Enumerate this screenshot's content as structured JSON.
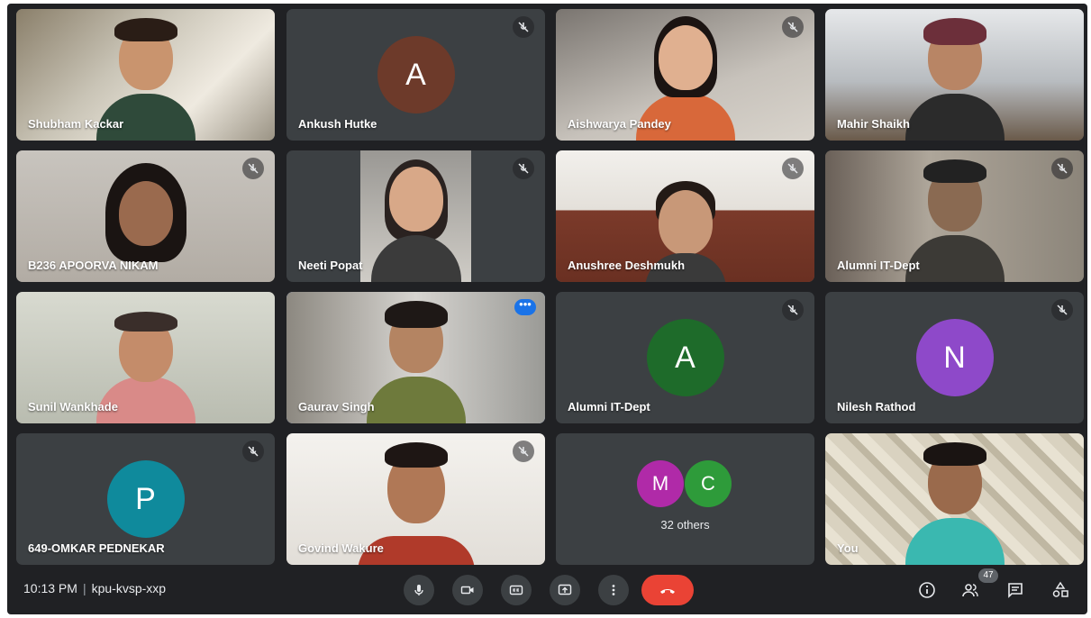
{
  "meeting": {
    "time": "10:13 PM",
    "separator": "|",
    "code": "kpu-kvsp-xxp"
  },
  "participants": [
    {
      "name": "Shubham Kackar"
    },
    {
      "name": "Ankush Hutke",
      "initial": "A"
    },
    {
      "name": "Aishwarya Pandey"
    },
    {
      "name": "Mahir Shaikh"
    },
    {
      "name": "B236 APOORVA NIKAM"
    },
    {
      "name": "Neeti Popat"
    },
    {
      "name": "Anushree Deshmukh"
    },
    {
      "name": "Alumni IT-Dept"
    },
    {
      "name": "Sunil Wankhade"
    },
    {
      "name": "Gaurav Singh",
      "more": "•••"
    },
    {
      "name": "Alumni IT-Dept",
      "initial": "A"
    },
    {
      "name": "Nilesh Rathod",
      "initial": "N"
    },
    {
      "name": "649-OMKAR PEDNEKAR",
      "initial": "P"
    },
    {
      "name": "Govind Wakure"
    },
    {
      "others_label": "32 others",
      "initials": [
        "M",
        "C"
      ]
    },
    {
      "name": "You"
    }
  ],
  "toolbar": {
    "participant_count": "47"
  },
  "colors": {
    "background": "#202124",
    "tile": "#3c4043",
    "hangup": "#ea4335",
    "avatar_brown": "#6d3a2a",
    "avatar_green": "#1e6b2a",
    "avatar_purple": "#8e49c9",
    "avatar_teal": "#0f8a9c",
    "avatar_magenta": "#b02aa8",
    "avatar_lime": "#2e9b3a",
    "active_outline": "#8ab4f8"
  },
  "icons": [
    "mic-off-icon",
    "mic-icon",
    "camera-icon",
    "captions-icon",
    "present-icon",
    "more-vert-icon",
    "hangup-icon",
    "info-icon",
    "people-icon",
    "chat-icon",
    "activities-icon"
  ]
}
